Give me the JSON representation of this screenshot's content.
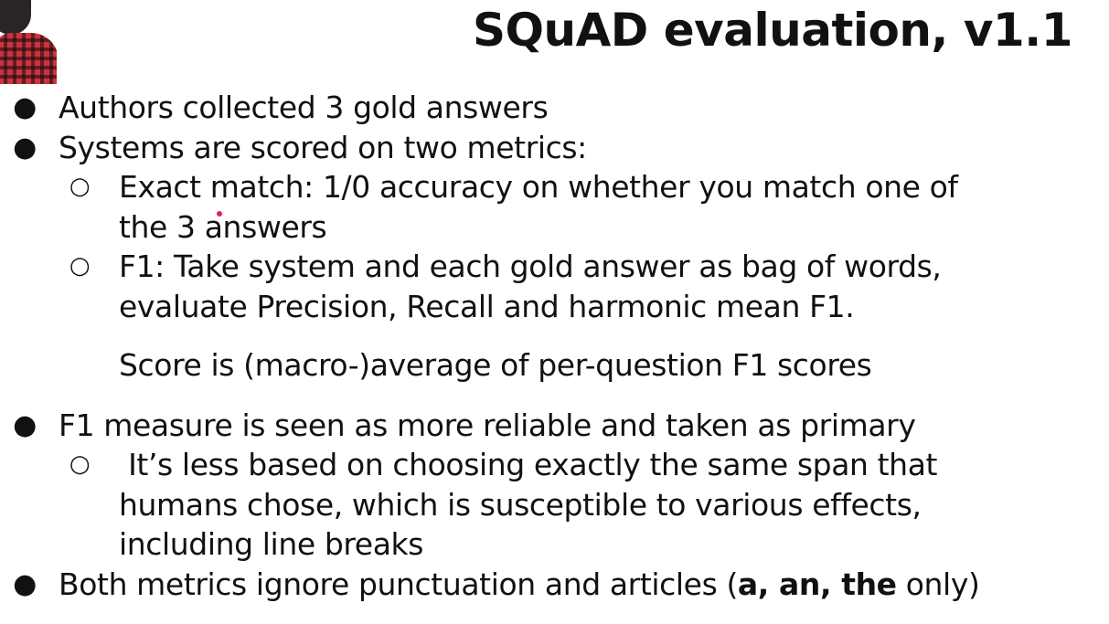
{
  "slide": {
    "title": "SQuAD evaluation, v1.1",
    "bullets": {
      "b1": "Authors collected 3 gold answers",
      "b2": "Systems are scored on two metrics:",
      "b2_sub1_line1": "Exact match: 1/0 accuracy on whether you match one of",
      "b2_sub1_line2": "the 3 answers",
      "b2_sub2_line1": "F1: Take system and each gold answer as bag of words,",
      "b2_sub2_line2": "evaluate Precision, Recall and harmonic mean F1.",
      "b2_note": "Score is (macro-)average of per-question F1 scores",
      "b3": "F1 measure is seen as more reliable and taken as primary",
      "b3_sub1_line1": " It’s less based on choosing exactly the same span that",
      "b3_sub1_line2": "humans chose, which is susceptible to various effects,",
      "b3_sub1_line3": "including line breaks",
      "b4_prefix": "Both metrics ignore punctuation and articles (",
      "b4_bold": "a, an, the",
      "b4_suffix": " only)"
    },
    "bullet_glyph": "●",
    "sub_bullet_glyph": "○"
  },
  "colors": {
    "text": "#111111",
    "background": "#ffffff",
    "pointer": "#e0245e"
  }
}
